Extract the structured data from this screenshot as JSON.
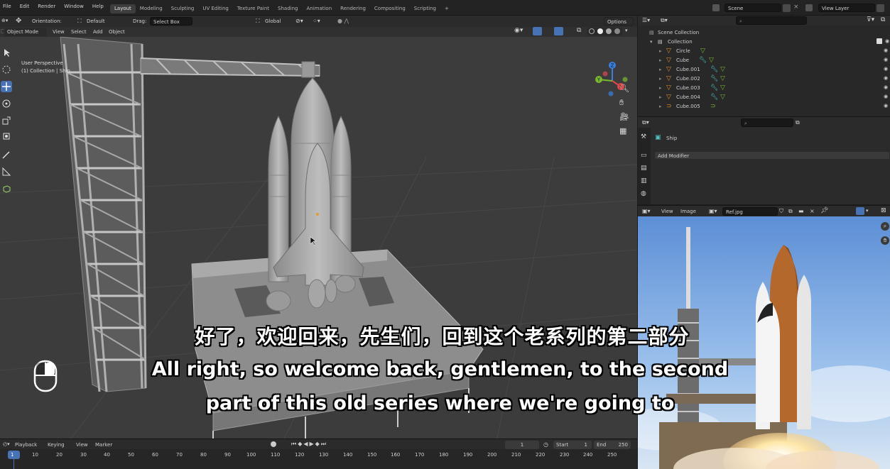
{
  "menu": [
    "File",
    "Edit",
    "Render",
    "Window",
    "Help"
  ],
  "workspaces": [
    "Layout",
    "Modeling",
    "Sculpting",
    "UV Editing",
    "Texture Paint",
    "Shading",
    "Animation",
    "Rendering",
    "Compositing",
    "Scripting"
  ],
  "active_workspace": "Layout",
  "scene_field": "Scene",
  "view_layer_field": "View Layer",
  "viewport_header": {
    "orientation_label": "Orientation:",
    "orientation_value": "Default",
    "drag_label": "Drag:",
    "drag_value": "Select Box",
    "transform_space": "Global",
    "options": "Options"
  },
  "viewport_header2": {
    "mode": "Object Mode",
    "items": [
      "View",
      "Select",
      "Add",
      "Object"
    ]
  },
  "viewport_info": {
    "perspective": "User Perspective",
    "collection": "(1) Collection | Ship"
  },
  "gizmo": {
    "x": "X",
    "y": "Y",
    "z": "Z"
  },
  "outliner": {
    "scene_collection": "Scene Collection",
    "collection": "Collection",
    "items": [
      "Circle",
      "Cube",
      "Cube.001",
      "Cube.002",
      "Cube.003",
      "Cube.004",
      "Cube.005"
    ]
  },
  "properties": {
    "object_name": "Ship",
    "add_modifier": "Add Modifier"
  },
  "image_editor": {
    "view": "View",
    "image": "Image",
    "filename": "Ref.jpg"
  },
  "timeline": {
    "menus": [
      "Playback",
      "Keying",
      "View",
      "Marker"
    ],
    "current_frame": "1",
    "start_label": "Start",
    "start_value": "1",
    "end_label": "End",
    "end_value": "250",
    "ticks": [
      "1",
      "10",
      "20",
      "30",
      "40",
      "50",
      "60",
      "70",
      "80",
      "90",
      "100",
      "110",
      "120",
      "130",
      "140",
      "150",
      "160",
      "170",
      "180",
      "190",
      "200",
      "210",
      "220",
      "230",
      "240",
      "250"
    ]
  },
  "subtitles": {
    "zh": "好了，欢迎回来，先生们，回到这个老系列的第二部分",
    "en_line1": "All right, so welcome back, gentlemen, to the second",
    "en_line2": "part of this old series where we're going to"
  },
  "colors": {
    "accent": "#4772b3",
    "viewport_bg": "#3d3d3d",
    "x_axis": "#e04848",
    "y_axis": "#7ab830",
    "z_axis": "#3a7fe0",
    "mesh_icon": "#e08a2c",
    "modifier_icon": "#4fc0c0"
  }
}
